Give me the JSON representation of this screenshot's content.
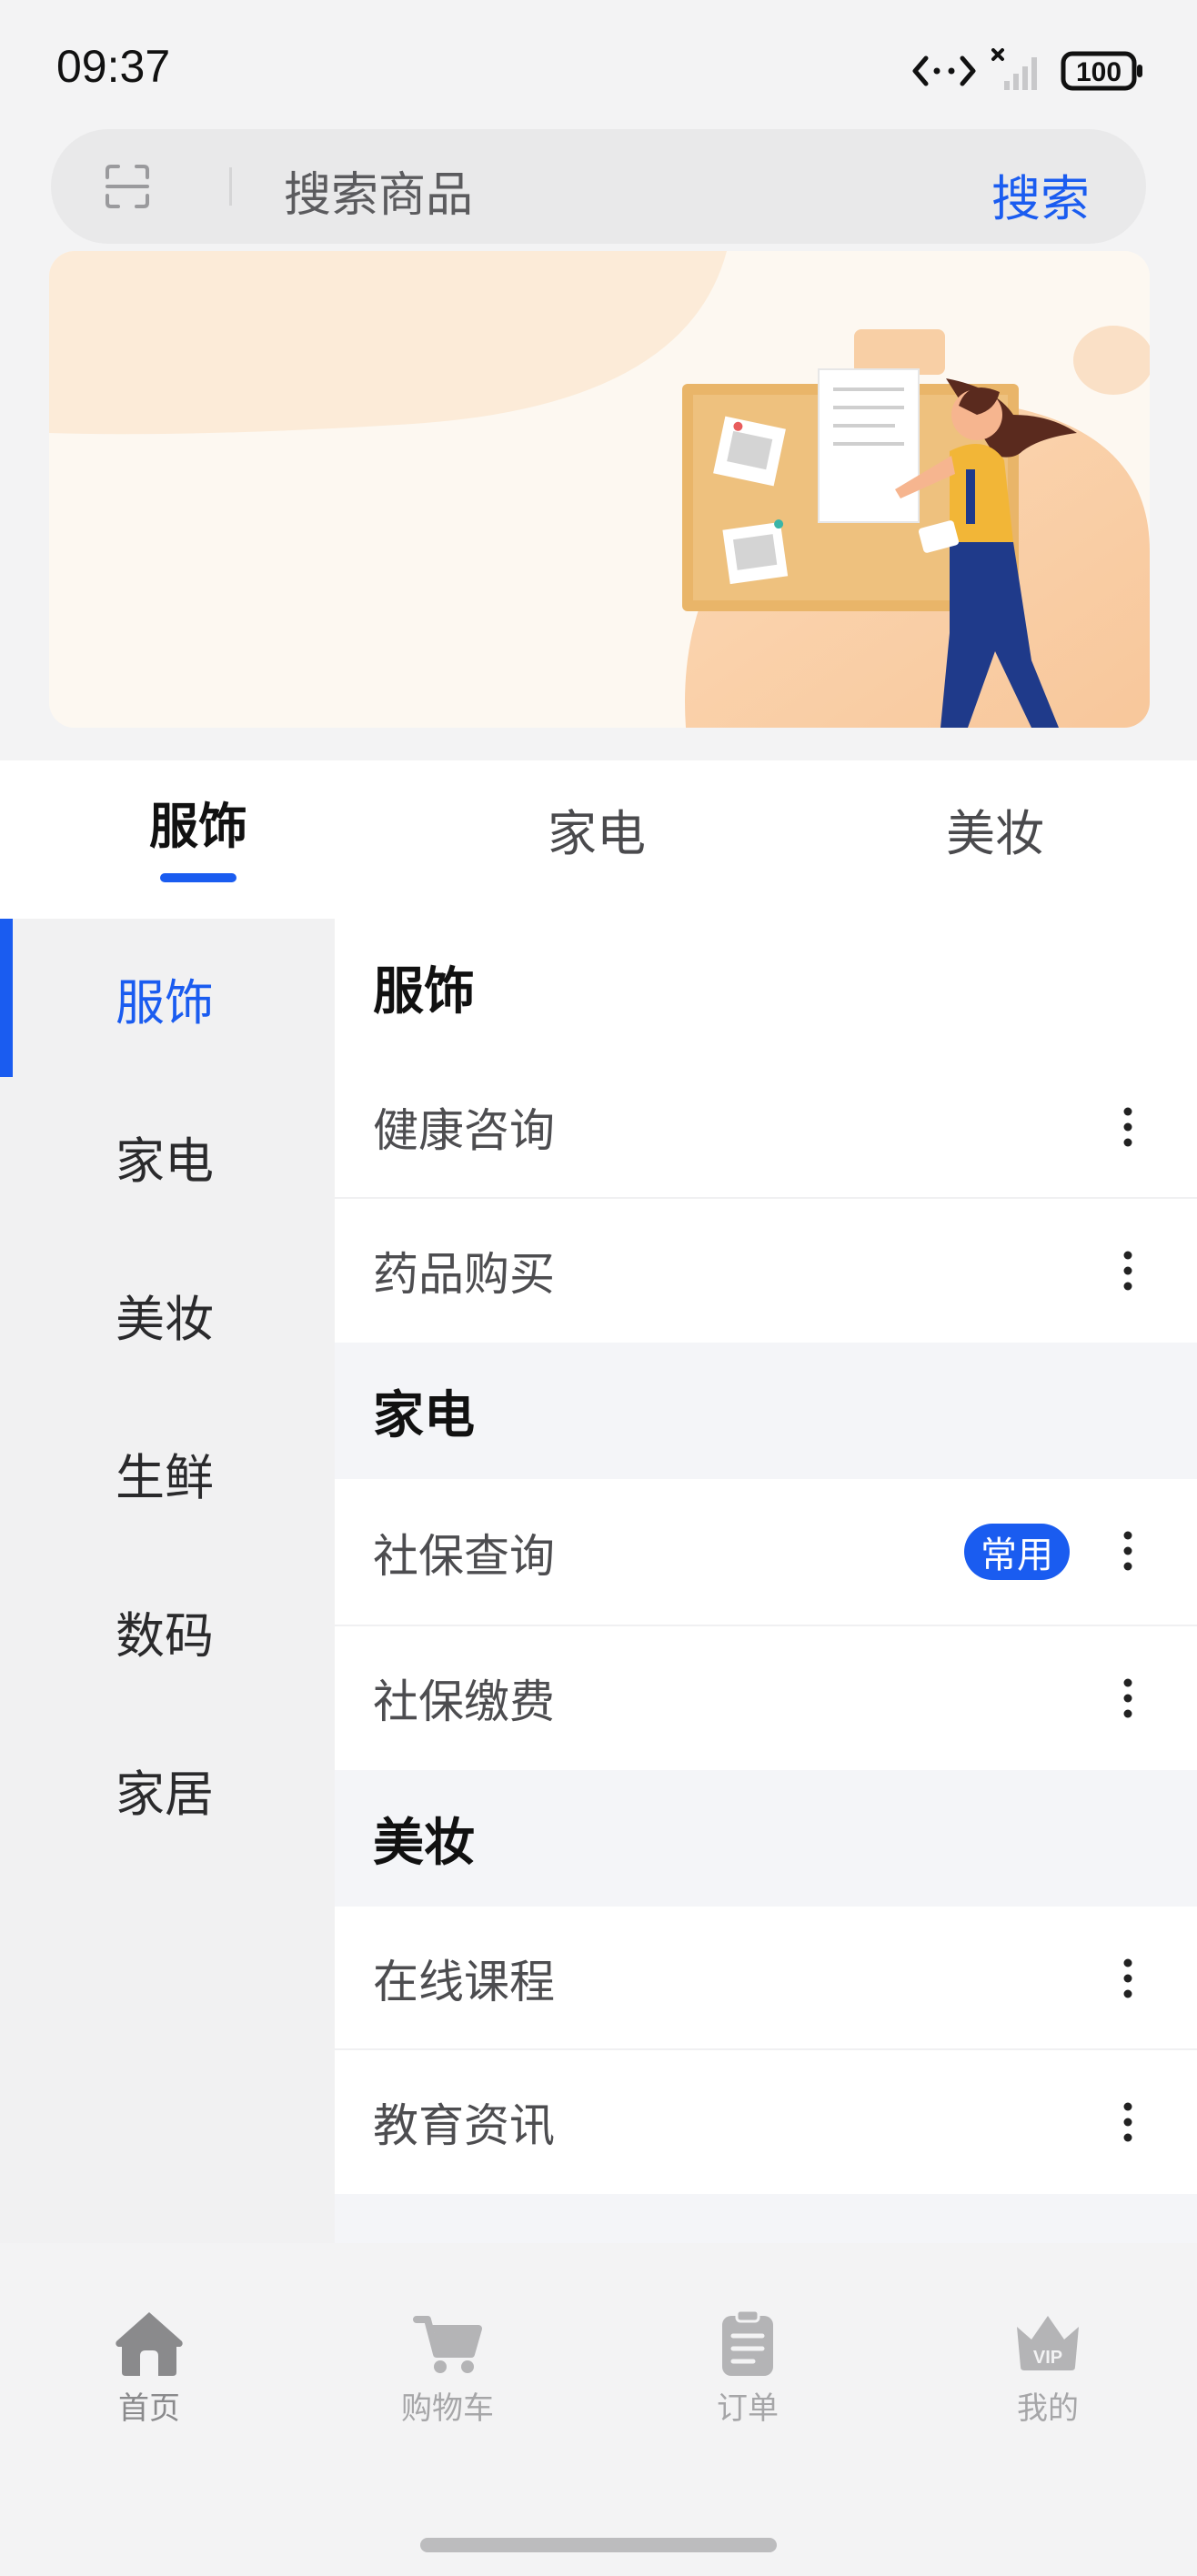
{
  "status_bar": {
    "time": "09:37",
    "battery": "100"
  },
  "search": {
    "placeholder": "搜索商品",
    "button_label": "搜索"
  },
  "top_tabs": [
    {
      "label": "服饰",
      "active": true
    },
    {
      "label": "家电",
      "active": false
    },
    {
      "label": "美妆",
      "active": false
    }
  ],
  "sidebar": {
    "items": [
      {
        "label": "服饰",
        "active": true
      },
      {
        "label": "家电",
        "active": false
      },
      {
        "label": "美妆",
        "active": false
      },
      {
        "label": "生鲜",
        "active": false
      },
      {
        "label": "数码",
        "active": false
      },
      {
        "label": "家居",
        "active": false
      }
    ]
  },
  "sections": [
    {
      "title": "服饰",
      "rows": [
        {
          "label": "健康咨询"
        },
        {
          "label": "药品购买"
        }
      ]
    },
    {
      "title": "家电",
      "rows": [
        {
          "label": "社保查询",
          "tag": "常用"
        },
        {
          "label": "社保缴费"
        }
      ]
    },
    {
      "title": "美妆",
      "rows": [
        {
          "label": "在线课程"
        },
        {
          "label": "教育资讯"
        }
      ]
    }
  ],
  "bottom_nav": [
    {
      "label": "首页",
      "icon": "home-icon",
      "active": true
    },
    {
      "label": "购物车",
      "icon": "cart-icon",
      "active": false
    },
    {
      "label": "订单",
      "icon": "order-icon",
      "active": false
    },
    {
      "label": "我的",
      "icon": "vip-crown-icon",
      "active": false
    }
  ],
  "colors": {
    "accent": "#1a5cf0",
    "page_bg": "#f3f3f4",
    "sidebar_bg": "#f1f1f2"
  }
}
